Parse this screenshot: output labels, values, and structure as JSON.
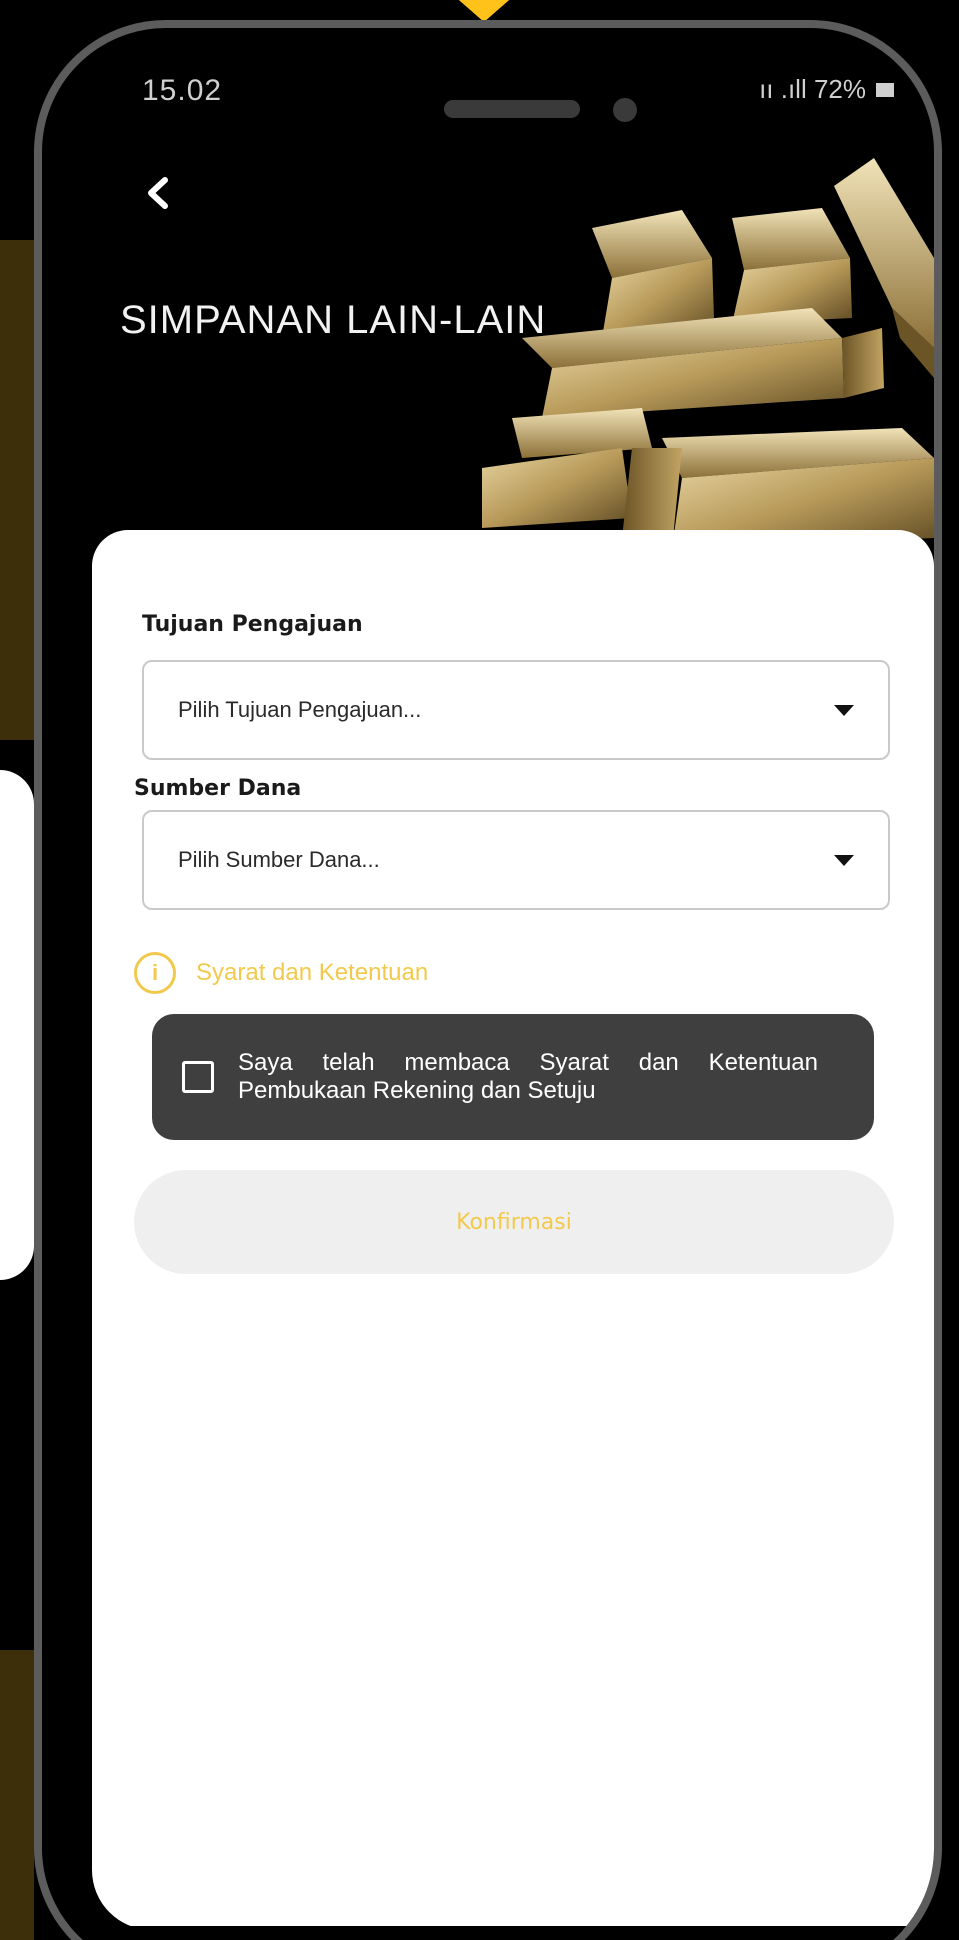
{
  "status_bar": {
    "time": "15.02",
    "indicators": "ıı .ıll 72%"
  },
  "header": {
    "back_icon": "chevron-left-icon",
    "title": "SIMPANAN LAIN-LAIN"
  },
  "form": {
    "purpose": {
      "label": "Tujuan Pengajuan",
      "placeholder": "Pilih Tujuan Pengajuan..."
    },
    "fund_source": {
      "label": "Sumber Dana",
      "placeholder": "Pilih Sumber Dana..."
    },
    "terms": {
      "icon": "info-icon",
      "link_text": "Syarat dan Ketentuan",
      "checkbox_label": "Saya telah membaca Syarat dan Ketentuan Pembukaan Rekening dan Setuju",
      "checked": false
    },
    "confirm_label": "Konfirmasi"
  },
  "colors": {
    "accent": "#f2c94c",
    "card": "#ffffff",
    "terms_box": "#3f3f3f",
    "button_bg": "#efefef"
  }
}
